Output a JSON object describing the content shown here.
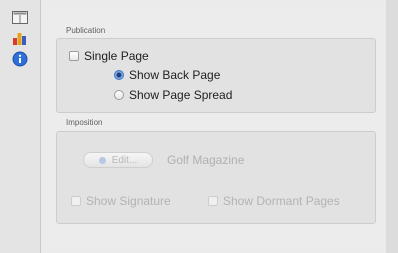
{
  "sidebar": {
    "tools": [
      {
        "icon": "layout-icon"
      },
      {
        "icon": "color-icon"
      },
      {
        "icon": "info-icon"
      }
    ]
  },
  "publication": {
    "title": "Publication",
    "single_page_label": "Single Page",
    "single_page_checked": false,
    "show_back_page_label": "Show Back Page",
    "show_back_page_selected": true,
    "show_page_spread_label": "Show Page Spread",
    "show_page_spread_selected": false
  },
  "imposition": {
    "title": "Imposition",
    "edit_button_label": "Edit...",
    "template_name": "Golf Magazine",
    "show_signature_label": "Show Signature",
    "show_dormant_pages_label": "Show Dormant Pages"
  },
  "colors": {
    "accent": "#3f78c9",
    "info_icon": "#2c6fd8",
    "disabled_text": "#b3b3b3"
  }
}
